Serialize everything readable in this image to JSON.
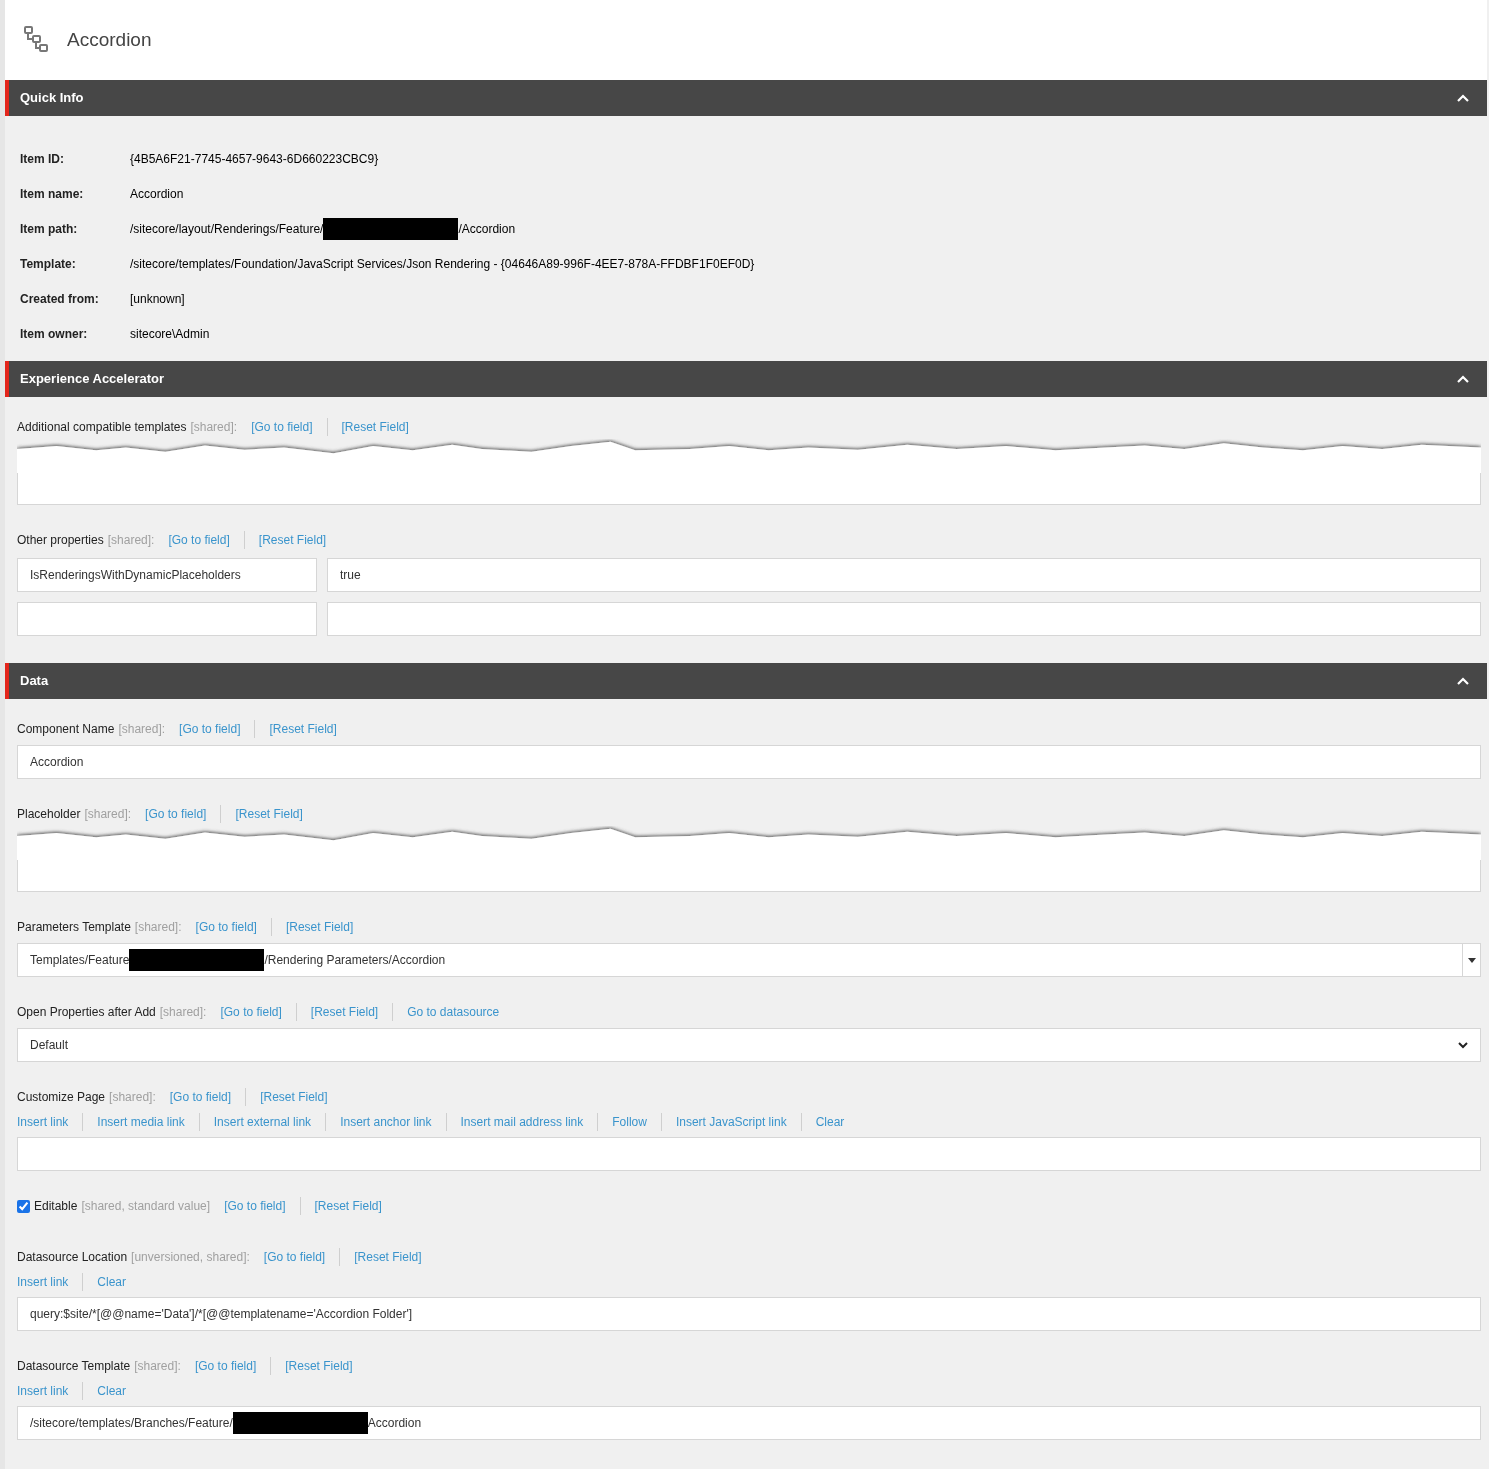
{
  "header": {
    "title": "Accordion"
  },
  "sections": [
    {
      "title": "Quick Info",
      "expanded": true,
      "kind": "info",
      "rows": [
        {
          "label": "Item ID:",
          "value": "{4B5A6F21-7745-4657-9643-6D660223CBC9}"
        },
        {
          "label": "Item name:",
          "value": "Accordion"
        },
        {
          "label": "Item path:",
          "value": "/sitecore/layout/Renderings/Feature/",
          "redacted": true,
          "value_after": "/Accordion"
        },
        {
          "label": "Template:",
          "value": "/sitecore/templates/Foundation/JavaScript Services/Json Rendering - {04646A89-996F-4EE7-878A-FFDBF1F0EF0D}"
        },
        {
          "label": "Created from:",
          "value": "[unknown]"
        },
        {
          "label": "Item owner:",
          "value": "sitecore\\Admin"
        }
      ]
    },
    {
      "title": "Experience Accelerator",
      "expanded": true,
      "kind": "fields",
      "fields": [
        {
          "kind": "tear",
          "label": "Additional compatible templates",
          "meta": "[shared]:",
          "links": [
            "[Go to field]",
            "[Reset Field]"
          ]
        },
        {
          "kind": "keyvalue",
          "label": "Other properties",
          "meta": "[shared]:",
          "links": [
            "[Go to field]",
            "[Reset Field]"
          ],
          "rows": [
            {
              "key": "IsRenderingsWithDynamicPlaceholders",
              "value": "true"
            },
            {}
          ]
        }
      ]
    },
    {
      "title": "Data",
      "expanded": true,
      "kind": "fields",
      "fields": [
        {
          "kind": "text",
          "label": "Component Name",
          "meta": "[shared]:",
          "links": [
            "[Go to field]",
            "[Reset Field]"
          ],
          "value": "Accordion"
        },
        {
          "kind": "tear",
          "label": "Placeholder",
          "meta": "[shared]:",
          "links": [
            "[Go to field]",
            "[Reset Field]"
          ]
        },
        {
          "kind": "droplink",
          "label": "Parameters Template",
          "meta": "[shared]:",
          "links": [
            "[Go to field]",
            "[Reset Field]"
          ],
          "value": "Templates/Feature",
          "redacted": true,
          "value_after": "/Rendering Parameters/Accordion"
        },
        {
          "kind": "select",
          "label": "Open Properties after Add",
          "meta": "[shared]:",
          "links": [
            "[Go to field]",
            "[Reset Field]",
            "Go to datasource"
          ],
          "value": "Default"
        },
        {
          "kind": "text",
          "label": "Customize Page",
          "meta": "[shared]:",
          "links": [
            "[Go to field]",
            "[Reset Field]"
          ],
          "actions": [
            "Insert link",
            "Insert media link",
            "Insert external link",
            "Insert anchor link",
            "Insert mail address link",
            "Follow",
            "Insert JavaScript link",
            "Clear"
          ]
        },
        {
          "kind": "checkbox",
          "label": "Editable",
          "meta": "[shared, standard value]",
          "links": [
            "[Go to field]",
            "[Reset Field]"
          ],
          "checked": true
        },
        {
          "kind": "text",
          "label": "Datasource Location",
          "meta": "[unversioned, shared]:",
          "links": [
            "[Go to field]",
            "[Reset Field]"
          ],
          "actions": [
            "Insert link",
            "Clear"
          ],
          "value": "query:$site/*[@@name='Data']/*[@@templatename='Accordion Folder']"
        },
        {
          "kind": "text",
          "label": "Datasource Template",
          "meta": "[shared]:",
          "links": [
            "[Go to field]",
            "[Reset Field]"
          ],
          "actions": [
            "Insert link",
            "Clear"
          ],
          "value": "/sitecore/templates/Branches/Feature/",
          "redacted": true,
          "value_after": "Accordion"
        }
      ]
    }
  ]
}
